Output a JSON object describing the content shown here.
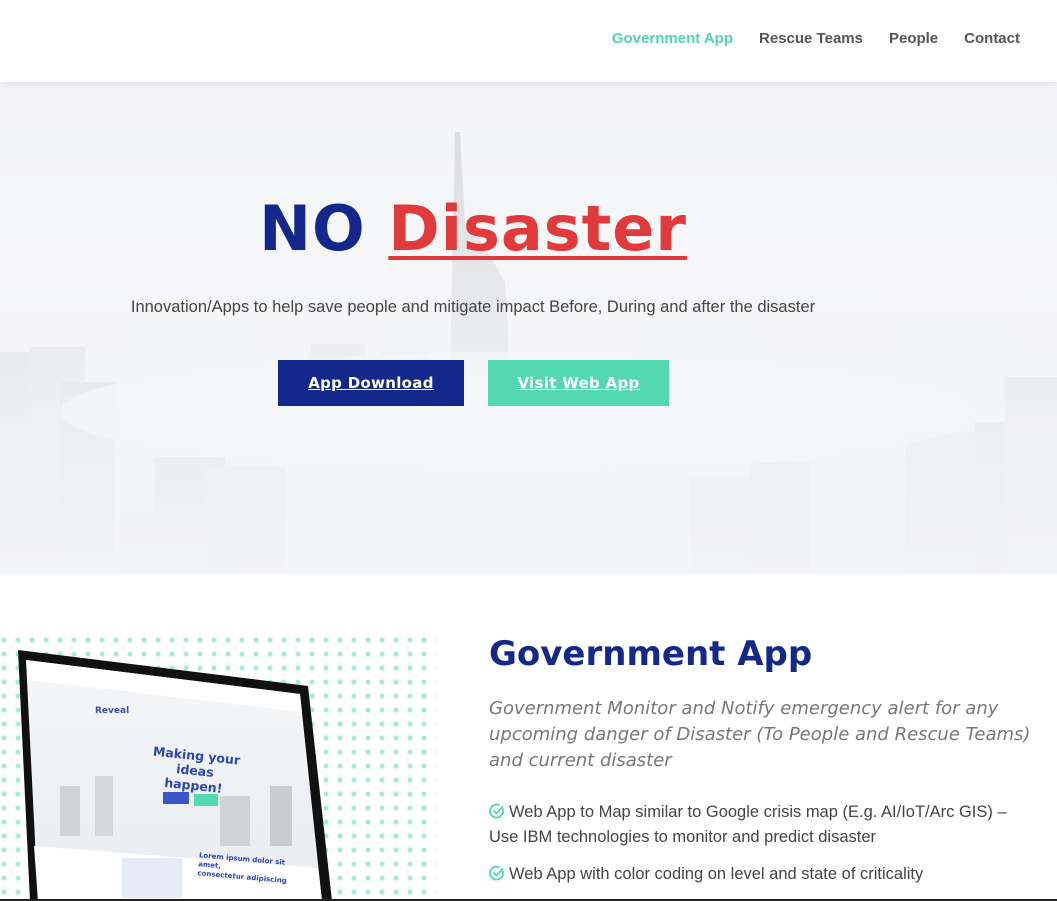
{
  "nav": {
    "items": [
      "Government App",
      "Rescue Teams",
      "People",
      "Contact"
    ],
    "active_index": 0
  },
  "hero": {
    "title_part1": "NO",
    "title_part2": "Disaster",
    "subtitle": "Innovation/Apps to help save people and mitigate impact Before, During and after the disaster",
    "primary_button": "App Download",
    "secondary_button": "Visit Web App"
  },
  "feature": {
    "title": "Government App",
    "lead": "Government Monitor and Notify emergency alert for any upcoming danger of Disaster (To People and Rescue Teams) and current disaster",
    "bullets": [
      "Web App to Map similar to Google crisis map (E.g. AI/IoT/Arc GIS) – Use IBM technologies to monitor and predict disaster",
      "Web App with color coding on level and state of criticality"
    ],
    "mockup": {
      "brand": "Reveal",
      "headline_line1": "Making your ideas",
      "headline_line2": "happen!",
      "caption_line1": "Lorem ipsum dolor sit amet,",
      "caption_line2": "consectetur adipiscing"
    }
  },
  "colors": {
    "brand_navy": "#13288a",
    "accent_green": "#52d6a8",
    "accent_red": "#e03a3a"
  },
  "icons": [
    "check-circle-icon"
  ]
}
